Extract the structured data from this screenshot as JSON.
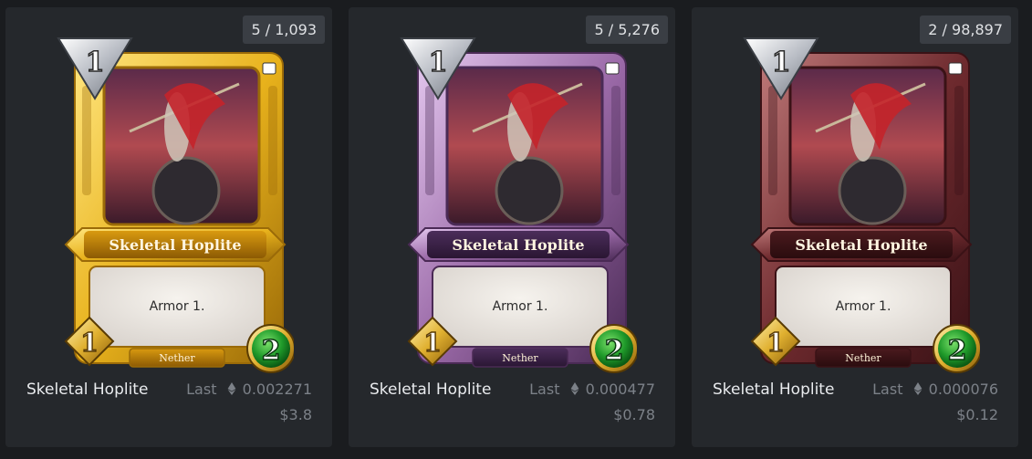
{
  "cards": [
    {
      "counter": "5 / 1,093",
      "card_title": "Skeletal Hoplite",
      "card_text": "Armor 1.",
      "card_set": "Nether",
      "mana": "1",
      "attack": "1",
      "health": "2",
      "name": "Skeletal Hoplite",
      "last_label": "Last",
      "price_eth": "0.002271",
      "price_usd": "$3.8",
      "frame": {
        "light": "#ffe680",
        "main": "#e8b21c",
        "dark": "#9a6a08",
        "banner": "#d99a10",
        "bannerDark": "#8c5a04",
        "art": "#7a3040"
      }
    },
    {
      "counter": "5 / 5,276",
      "card_title": "Skeletal Hoplite",
      "card_text": "Armor 1.",
      "card_set": "Nether",
      "mana": "1",
      "attack": "1",
      "health": "2",
      "name": "Skeletal Hoplite",
      "last_label": "Last",
      "price_eth": "0.000477",
      "price_usd": "$0.78",
      "frame": {
        "light": "#e4c8ef",
        "main": "#9b6aa8",
        "dark": "#4a2a55",
        "banner": "#4b2d5a",
        "bannerDark": "#2a1633",
        "art": "#7a3040"
      }
    },
    {
      "counter": "2 / 98,897",
      "card_title": "Skeletal Hoplite",
      "card_text": "Armor 1.",
      "card_set": "Nether",
      "mana": "1",
      "attack": "1",
      "health": "2",
      "name": "Skeletal Hoplite",
      "last_label": "Last",
      "price_eth": "0.000076",
      "price_usd": "$0.12",
      "frame": {
        "light": "#c07a7a",
        "main": "#6e2a2e",
        "dark": "#3a1216",
        "banner": "#4a1a1e",
        "bannerDark": "#2a0c0e",
        "art": "#7a3040"
      }
    }
  ]
}
